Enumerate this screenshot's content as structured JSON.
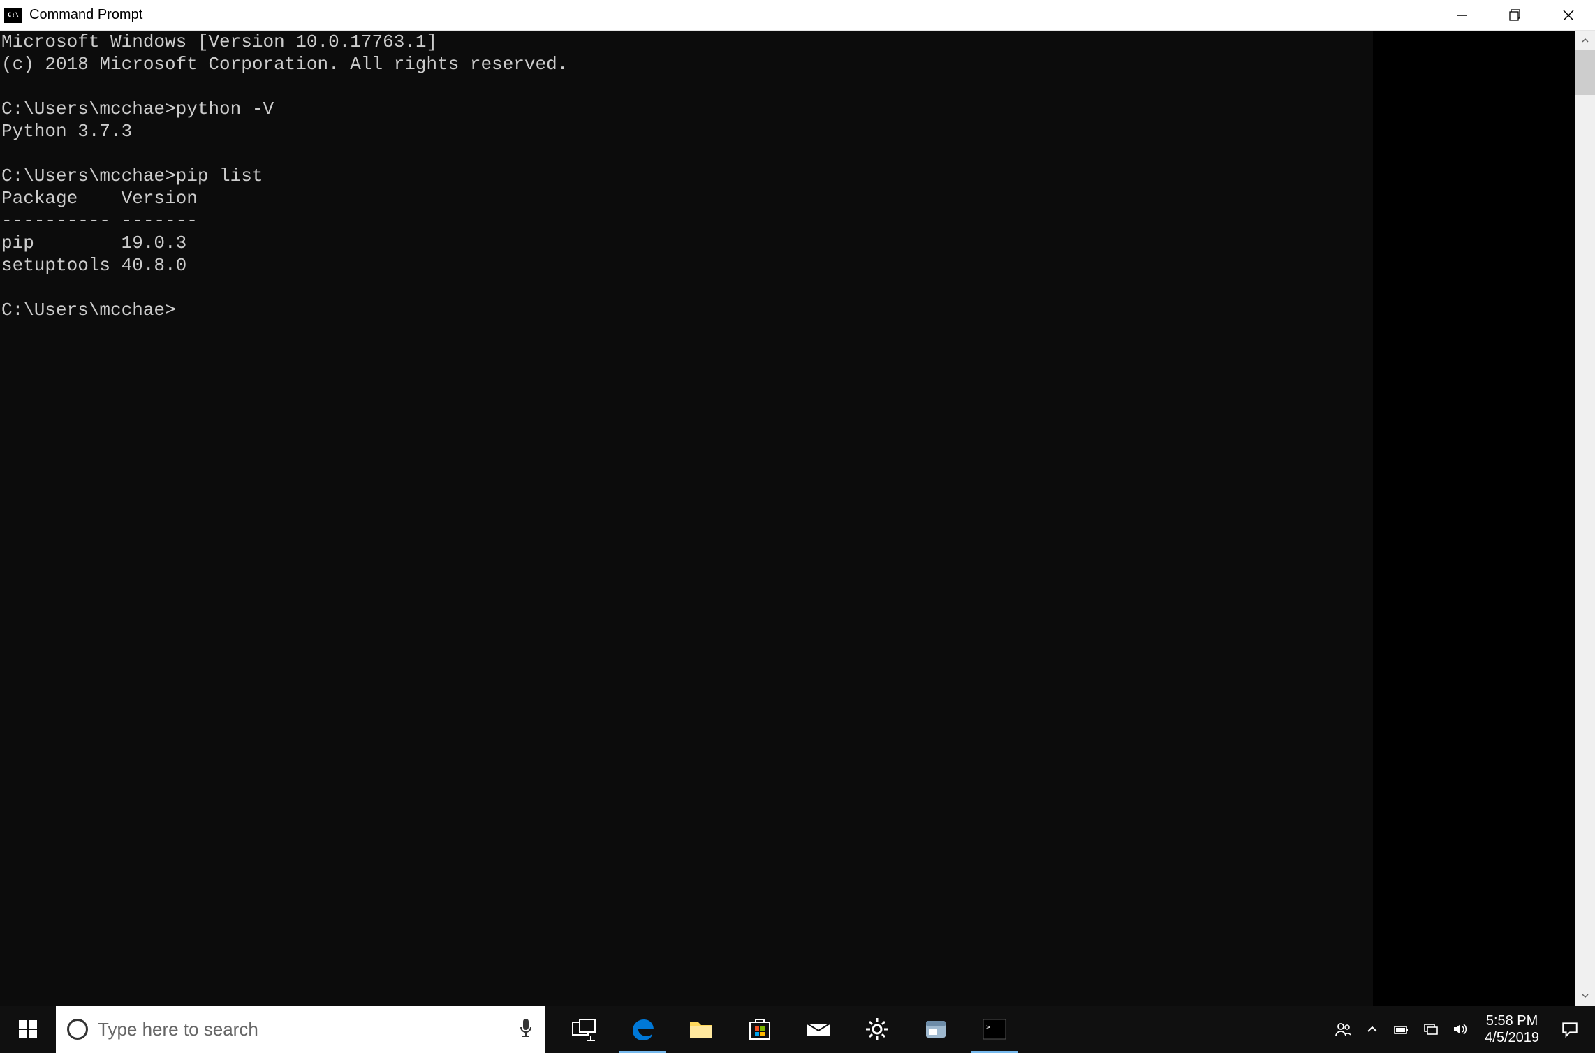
{
  "window": {
    "title": "Command Prompt",
    "icon_label": "C:\\"
  },
  "terminal": {
    "lines": [
      "Microsoft Windows [Version 10.0.17763.1]",
      "(c) 2018 Microsoft Corporation. All rights reserved.",
      "",
      "C:\\Users\\mcchae>python -V",
      "Python 3.7.3",
      "",
      "C:\\Users\\mcchae>pip list",
      "Package    Version",
      "---------- -------",
      "pip        19.0.3",
      "setuptools 40.8.0",
      "",
      "C:\\Users\\mcchae>"
    ]
  },
  "taskbar": {
    "search_placeholder": "Type here to search"
  },
  "tray": {
    "time": "5:58 PM",
    "date": "4/5/2019"
  }
}
